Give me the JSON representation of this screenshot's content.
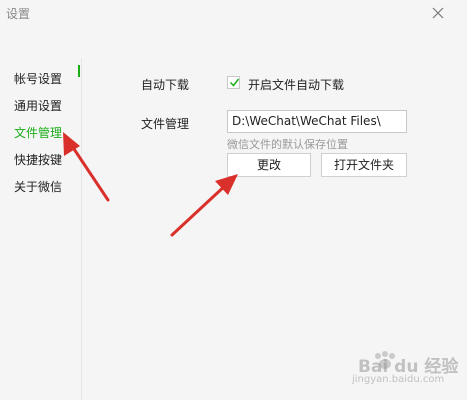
{
  "window": {
    "title": "设置"
  },
  "sidebar": {
    "items": [
      {
        "label": "帐号设置"
      },
      {
        "label": "通用设置"
      },
      {
        "label": "文件管理"
      },
      {
        "label": "快捷按键"
      },
      {
        "label": "关于微信"
      }
    ],
    "active_index": 2
  },
  "settings": {
    "auto_download": {
      "label": "自动下载",
      "checkbox_label": "开启文件自动下载",
      "checked": true
    },
    "file_management": {
      "label": "文件管理",
      "path": "D:\\WeChat\\WeChat Files\\",
      "hint": "微信文件的默认保存位置",
      "change_button": "更改",
      "open_folder_button": "打开文件夹"
    }
  },
  "annotations": {
    "arrow_color": "#d9302b"
  },
  "watermark": {
    "text": "Bai du 经验",
    "sub": "jingyan.baidu.com"
  },
  "colors": {
    "accent": "#1aad19",
    "background": "#f5f5f5"
  }
}
